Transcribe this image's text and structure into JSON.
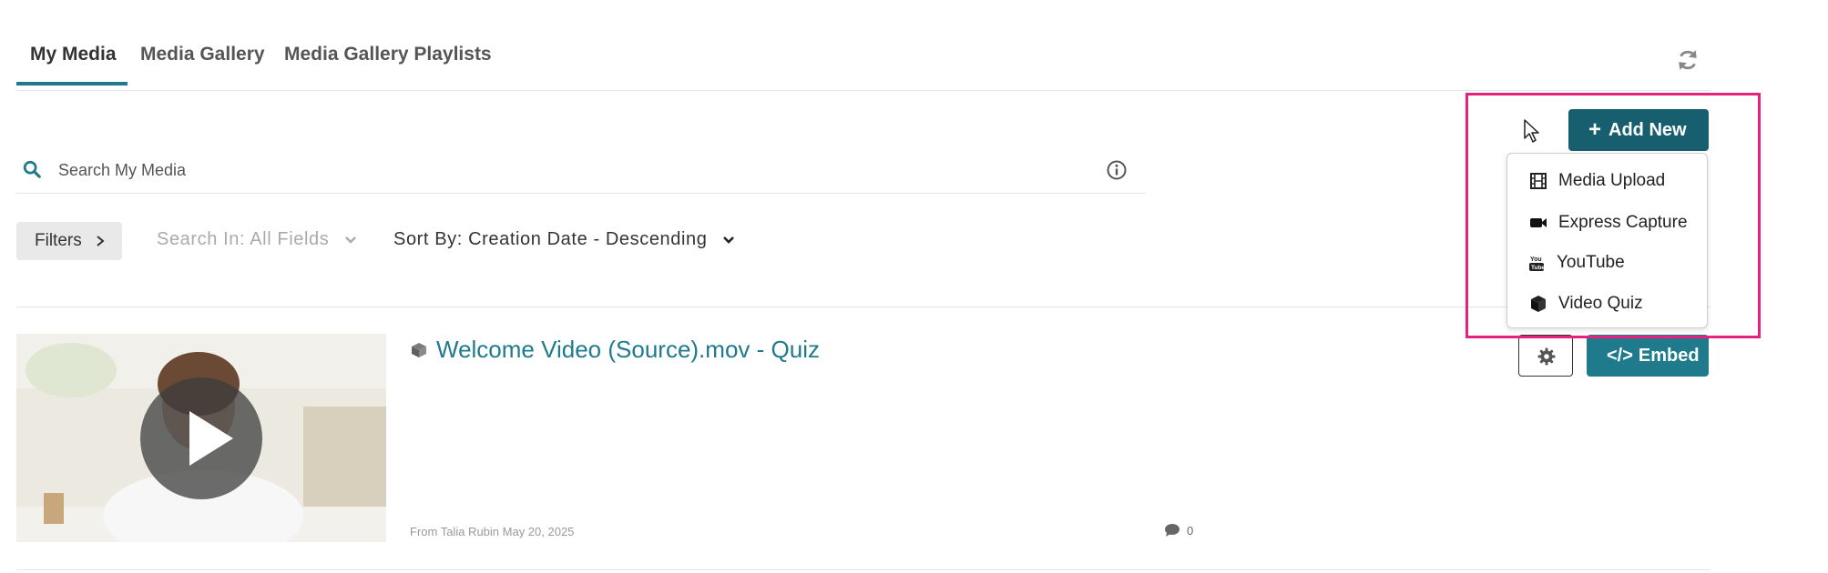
{
  "tabs": [
    {
      "label": "My Media",
      "active": true
    },
    {
      "label": "Media Gallery",
      "active": false
    },
    {
      "label": "Media Gallery Playlists",
      "active": false
    }
  ],
  "search": {
    "placeholder": "Search My Media"
  },
  "toolbar": {
    "filters_label": "Filters",
    "search_in_label": "Search In: All Fields",
    "sort_by_label": "Sort By: Creation Date - Descending"
  },
  "add_new": {
    "label": "Add New",
    "menu": [
      {
        "label": "Media Upload",
        "icon": "film-icon"
      },
      {
        "label": "Express Capture",
        "icon": "video-camera-icon"
      },
      {
        "label": "YouTube",
        "icon": "youtube-icon"
      },
      {
        "label": "Video Quiz",
        "icon": "cube-icon"
      }
    ]
  },
  "entry": {
    "title": "Welcome Video (Source).mov - Quiz",
    "meta": "From Talia Rubin May 20, 2025",
    "comment_count": "0",
    "embed_label": "Embed"
  },
  "colors": {
    "accent": "#1f7a8c",
    "add_new_bg": "#175f6e",
    "highlight": "#e5227f"
  }
}
